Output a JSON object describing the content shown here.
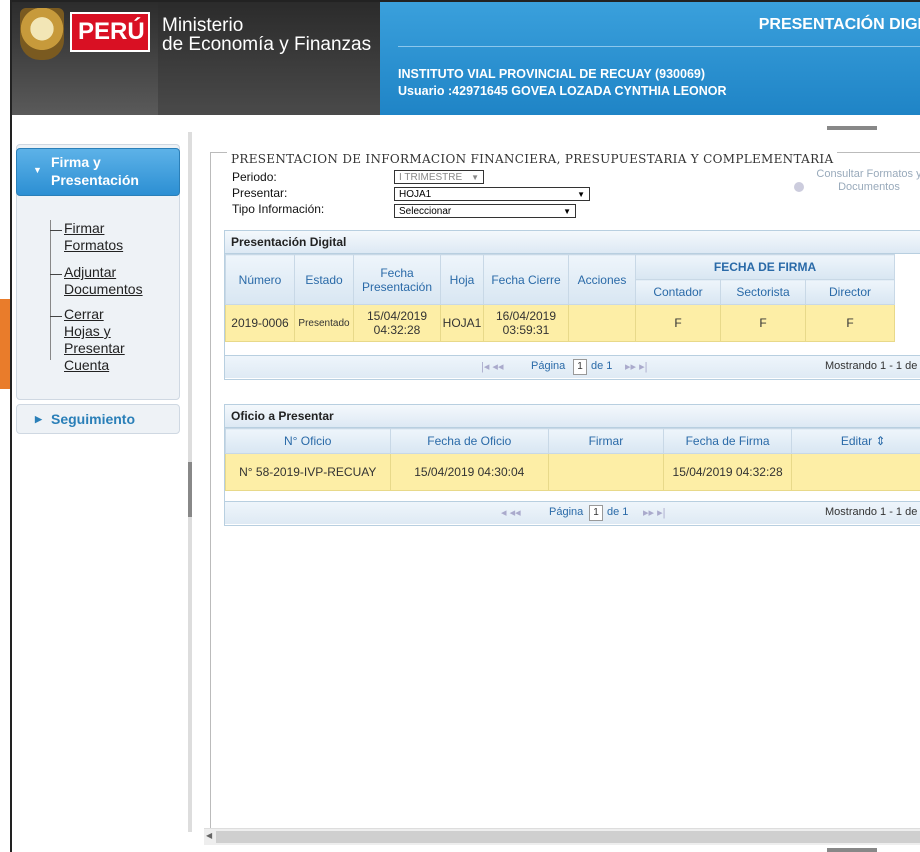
{
  "header": {
    "country": "PERÚ",
    "ministry_line1": "Ministerio",
    "ministry_line2": "de Economía y Finanzas",
    "page_title": "PRESENTACIÓN DIGI",
    "institution": "INSTITUTO VIAL PROVINCIAL DE RECUAY (930069)",
    "user": "Usuario :42971645 GOVEA LOZADA CYNTHIA LEONOR"
  },
  "sidebar": {
    "section1": {
      "line1": "Firma y",
      "line2": "Presentación"
    },
    "items": [
      {
        "l1": "Firmar",
        "l2": "Formatos"
      },
      {
        "l1": "Adjuntar",
        "l2": "Documentos"
      },
      {
        "l1": "Cerrar",
        "l2": "Hojas y",
        "l3": "Presentar",
        "l4": "Cuenta"
      }
    ],
    "section2": "Seguimiento"
  },
  "form": {
    "legend": "PRESENTACION DE INFORMACION FINANCIERA, PRESUPUESTARIA Y COMPLEMENTARIA",
    "periodo_label": "Periodo:",
    "periodo_value": "I TRIMESTRE",
    "presentar_label": "Presentar:",
    "presentar_value": "HOJA1",
    "tipo_label": "Tipo Información:",
    "tipo_value": "Seleccionar",
    "consult_l1": "Consultar Formatos y",
    "consult_l2": "Documentos"
  },
  "grid1": {
    "title": "Presentación Digital",
    "headers": {
      "numero": "Número",
      "estado": "Estado",
      "fecha_pres_1": "Fecha",
      "fecha_pres_2": "Presentación",
      "hoja": "Hoja",
      "fecha_cierre": "Fecha Cierre",
      "acciones": "Acciones",
      "fecha_firma": "FECHA DE FIRMA",
      "contador": "Contador",
      "sectorista": "Sectorista",
      "director": "Director"
    },
    "row": {
      "numero": "2019-0006",
      "estado": "Presentado",
      "fp1": "15/04/2019",
      "fp2": "04:32:28",
      "hoja": "HOJA1",
      "fc1": "16/04/2019",
      "fc2": "03:59:31",
      "acciones": "",
      "contador": "F",
      "sectorista": "F",
      "director": "F"
    },
    "pager": {
      "pagina": "Página",
      "page": "1",
      "de": "de 1",
      "mostrando": "Mostrando 1 - 1 de"
    }
  },
  "grid2": {
    "title": "Oficio a Presentar",
    "headers": {
      "oficio": "N° Oficio",
      "fecha_oficio": "Fecha de Oficio",
      "firmar": "Firmar",
      "fecha_firma": "Fecha de Firma",
      "editar": "Editar"
    },
    "row": {
      "oficio": "N° 58-2019-IVP-RECUAY",
      "fecha_oficio": "15/04/2019 04:30:04",
      "firmar": "",
      "fecha_firma": "15/04/2019  04:32:28",
      "editar": ""
    },
    "pager": {
      "pagina": "Página",
      "page": "1",
      "de": "de 1",
      "mostrando": "Mostrando 1 - 1 de"
    }
  },
  "colors": {
    "header_blue": "#1f84c6",
    "highlight_row": "#fdeea6",
    "arrow": "#e97c2b"
  }
}
